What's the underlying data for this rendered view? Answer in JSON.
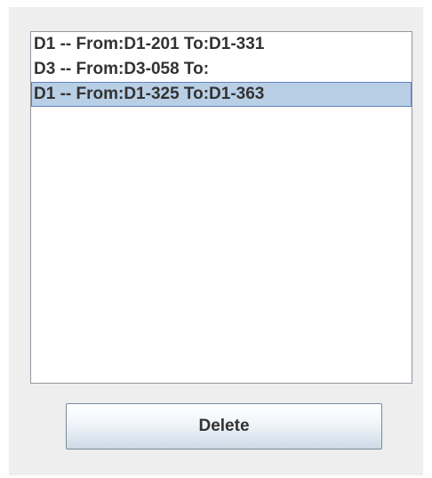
{
  "list": {
    "items": [
      {
        "label": "D1 -- From:D1-201 To:D1-331",
        "selected": false
      },
      {
        "label": "D3 -- From:D3-058 To:",
        "selected": false
      },
      {
        "label": "D1 -- From:D1-325 To:D1-363",
        "selected": true
      }
    ]
  },
  "actions": {
    "delete_label": "Delete"
  },
  "colors": {
    "panel_background": "#eeeeee",
    "selection_fill": "#b8cfe5",
    "selection_border": "#6382bf"
  }
}
